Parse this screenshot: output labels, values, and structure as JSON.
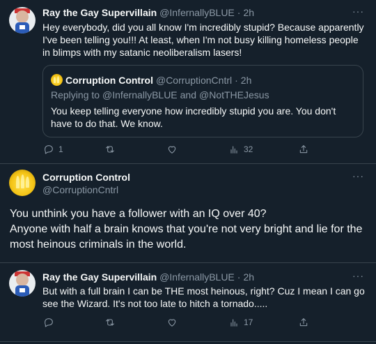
{
  "tweet1": {
    "name": "Ray the Gay Supervillain",
    "handle": "@InfernallyBLUE",
    "sep": "·",
    "time": "2h",
    "text": "Hey everybody, did you all know I'm incredibly stupid? Because apparently\nI've been telling you!!! At least, when I'm not busy killing homeless people\nin blimps with my satanic neoliberalism lasers!",
    "more": "···",
    "quote": {
      "name": "Corruption Control",
      "handle": "@CorruptionCntrl",
      "sep": "·",
      "time": "2h",
      "replying_prefix": "Replying to",
      "replying_to_1": "@InfernallyBLUE",
      "replying_and": "and",
      "replying_to_2": "@NotTHEJesus",
      "text": "You keep telling everyone how incredibly stupid you are.  You don't\nhave to do that.  We know."
    },
    "actions": {
      "replies": "1",
      "retweets": "",
      "likes": "",
      "views": "32"
    }
  },
  "tweet2": {
    "name": "Corruption Control",
    "handle": "@CorruptionCntrl",
    "more": "···",
    "text_line1": "You unthink you have a follower with an IQ over 40?",
    "text_line2": "Anyone with half a brain knows that you're not very bright and lie for the",
    "text_line3": "most heinous criminals in the world."
  },
  "tweet3": {
    "name": "Ray the Gay Supervillain",
    "handle": "@InfernallyBLUE",
    "sep": "·",
    "time": "2h",
    "more": "···",
    "text": "But with a full brain I can be THE most heinous, right? Cuz I mean I can go\nsee the Wizard. It's not too late to hitch a tornado.....",
    "actions": {
      "replies": "",
      "retweets": "",
      "likes": "",
      "views": "17"
    }
  },
  "icons": {
    "reply": "reply-icon",
    "retweet": "retweet-icon",
    "like": "heart-icon",
    "views": "views-icon",
    "share": "share-icon",
    "more": "more-icon"
  },
  "colors": {
    "background": "#15202b",
    "text": "#f7f9f9",
    "secondary": "#8b98a5",
    "border": "#38444d"
  }
}
